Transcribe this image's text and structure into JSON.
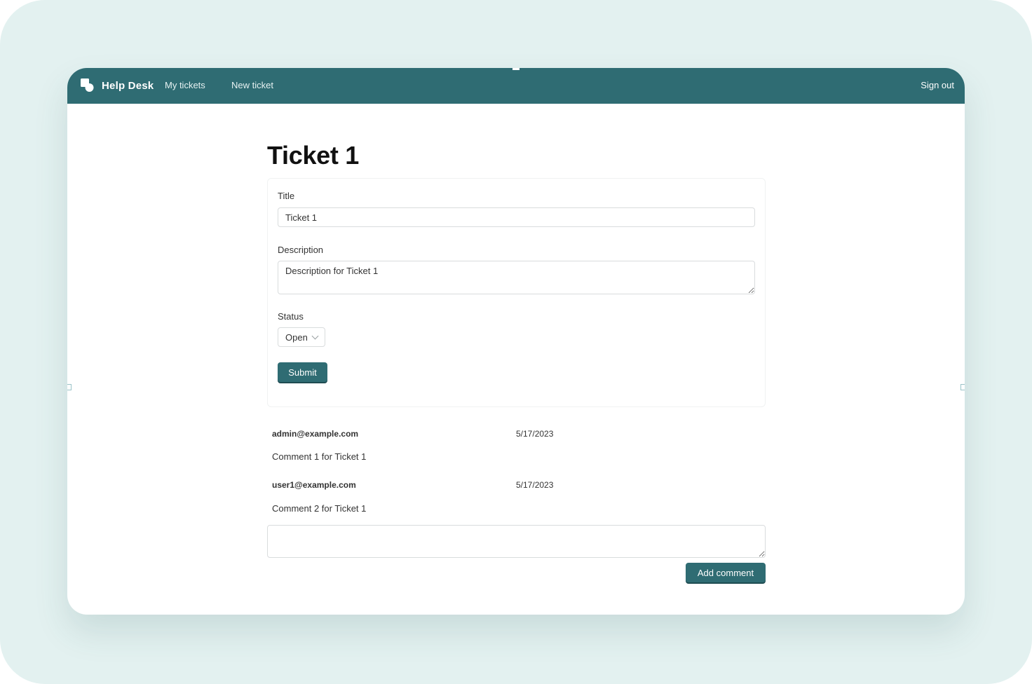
{
  "header": {
    "brand": "Help Desk",
    "nav": [
      {
        "label": "My tickets"
      },
      {
        "label": "New ticket"
      }
    ],
    "sign_out": "Sign out",
    "color": "#2f6c73"
  },
  "ticket": {
    "heading": "Ticket 1",
    "title_label": "Title",
    "title_value": "Ticket 1",
    "description_label": "Description",
    "description_value": "Description for Ticket 1",
    "status_label": "Status",
    "status_value": "Open",
    "submit_label": "Submit"
  },
  "comments": [
    {
      "author": "admin@example.com",
      "date": "5/17/2023",
      "body": "Comment 1 for Ticket 1"
    },
    {
      "author": "user1@example.com",
      "date": "5/17/2023",
      "body": "Comment 2 for Ticket 1"
    }
  ],
  "new_comment": {
    "value": "",
    "button_label": "Add comment"
  },
  "icons": {
    "logo": "help-desk-logo-icon",
    "status_dropdown": "chevron-down-icon"
  }
}
